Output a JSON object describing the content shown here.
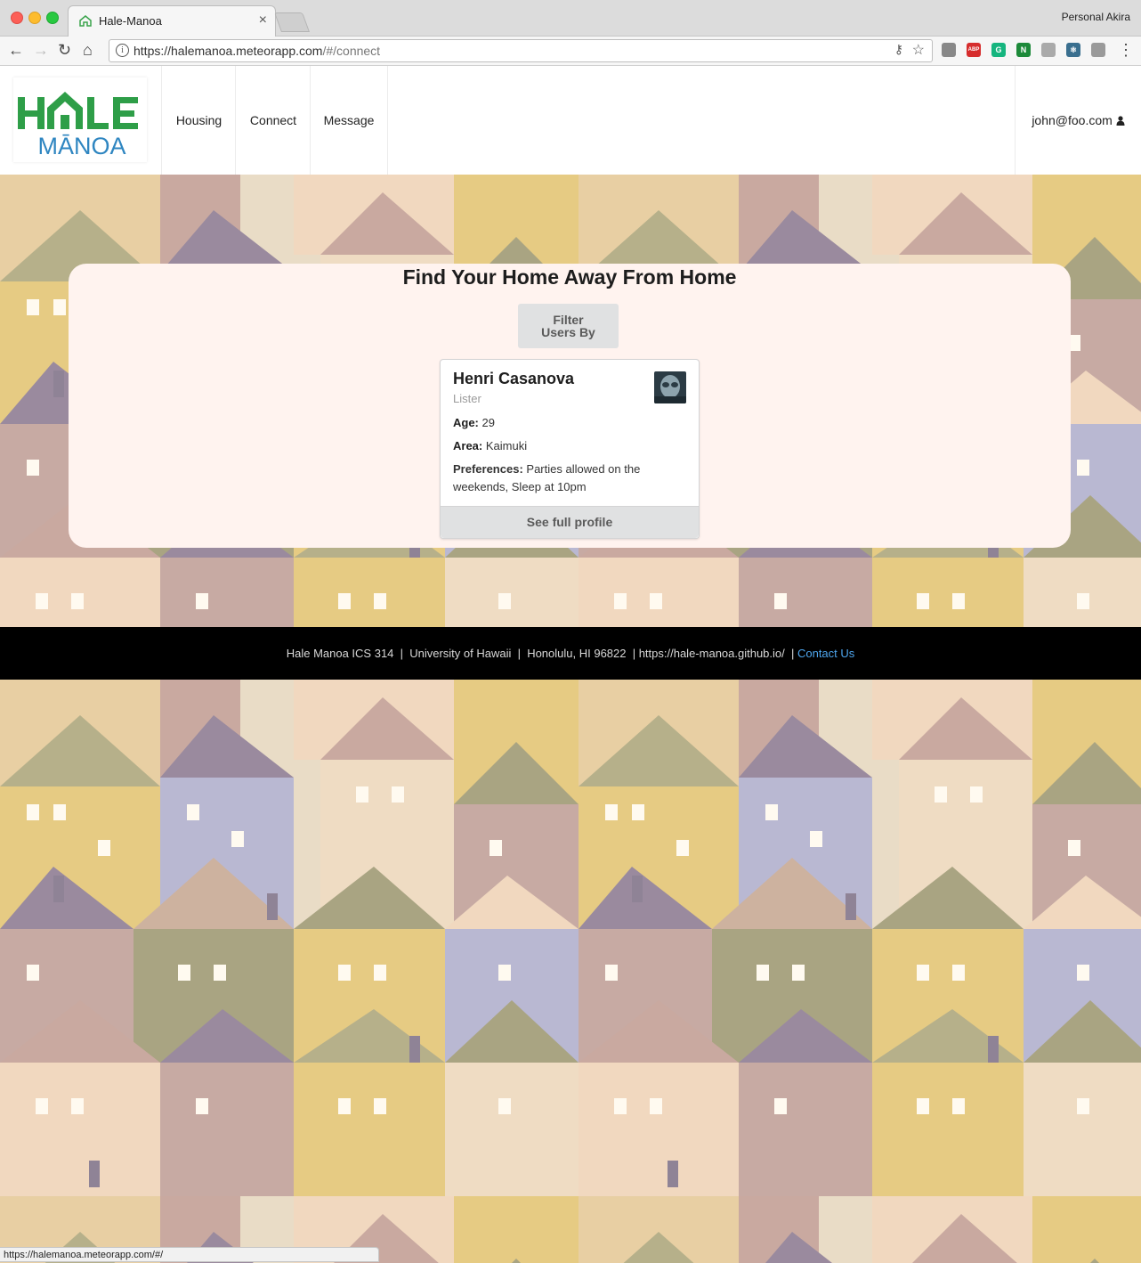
{
  "browser": {
    "tab_title": "Hale-Manoa",
    "tab_close": "×",
    "profile_name": "Personal Akira",
    "url_host": "https://halemanoa.meteorapp.com",
    "url_path": "/#/connect",
    "back": "←",
    "forward": "→",
    "reload": "↻",
    "home": "⌂",
    "info": "i",
    "key": "⚷",
    "star": "☆",
    "status_url": "https://halemanoa.meteorapp.com/#/",
    "extensions": [
      {
        "name": "cast-icon",
        "label": "",
        "color": "#888888"
      },
      {
        "name": "adblock-icon",
        "label": "ABP",
        "color": "#d62d2d"
      },
      {
        "name": "grammarly-icon",
        "label": "G",
        "color": "#16b57f"
      },
      {
        "name": "n-extension-icon",
        "label": "N",
        "color": "#1d8a3a"
      },
      {
        "name": "palette-icon",
        "label": "",
        "color": "#aaaaaa"
      },
      {
        "name": "react-devtools-icon",
        "label": "⚛",
        "color": "#3a6f8f"
      },
      {
        "name": "extension-icon",
        "label": "",
        "color": "#9a9a9a"
      }
    ]
  },
  "logo": {
    "top": "HALE",
    "bottom": "MĀNOA",
    "green": "#2e9e48",
    "blue": "#2f86c1"
  },
  "nav": {
    "items": [
      "Housing",
      "Connect",
      "Message"
    ],
    "user": "john@foo.com"
  },
  "main": {
    "heading": "Find Your Home Away From Home",
    "filter_line1": "Filter",
    "filter_line2": "Users By"
  },
  "profile_card": {
    "name": "Henri Casanova",
    "role": "Lister",
    "age_label": "Age:",
    "age": "29",
    "area_label": "Area:",
    "area": "Kaimuki",
    "pref_label": "Preferences:",
    "preferences": "Parties allowed on the weekends, Sleep at 10pm",
    "button": "See full profile"
  },
  "footer": {
    "text": "Hale Manoa ICS 314  |  University of Hawaii  |  Honolulu, HI 96822  | https://hale-manoa.github.io/  | ",
    "contact": "Contact Us"
  }
}
